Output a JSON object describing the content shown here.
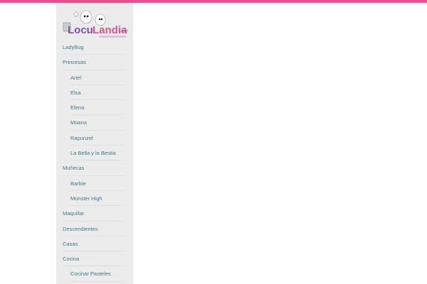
{
  "brand": {
    "logo_text": "LocuLandia",
    "logo_suffix": ".com",
    "color_accent": "#e9508a"
  },
  "menu": [
    {
      "label": "LadyBug",
      "level": 0
    },
    {
      "label": "Princesas",
      "level": 0
    },
    {
      "label": "Ariel",
      "level": 1
    },
    {
      "label": "Elsa",
      "level": 1
    },
    {
      "label": "Elena",
      "level": 1
    },
    {
      "label": "Moana",
      "level": 1
    },
    {
      "label": "Rapunzel",
      "level": 1
    },
    {
      "label": "La Bella y la Bestia",
      "level": 1
    },
    {
      "label": "Muñecas",
      "level": 0
    },
    {
      "label": "Barbie",
      "level": 1
    },
    {
      "label": "Monster High",
      "level": 1
    },
    {
      "label": "Maquillar",
      "level": 0
    },
    {
      "label": "Descendientes",
      "level": 0
    },
    {
      "label": "Casas",
      "level": 0
    },
    {
      "label": "Cocina",
      "level": 0
    },
    {
      "label": "Cocinar Pasteles",
      "level": 1
    }
  ]
}
